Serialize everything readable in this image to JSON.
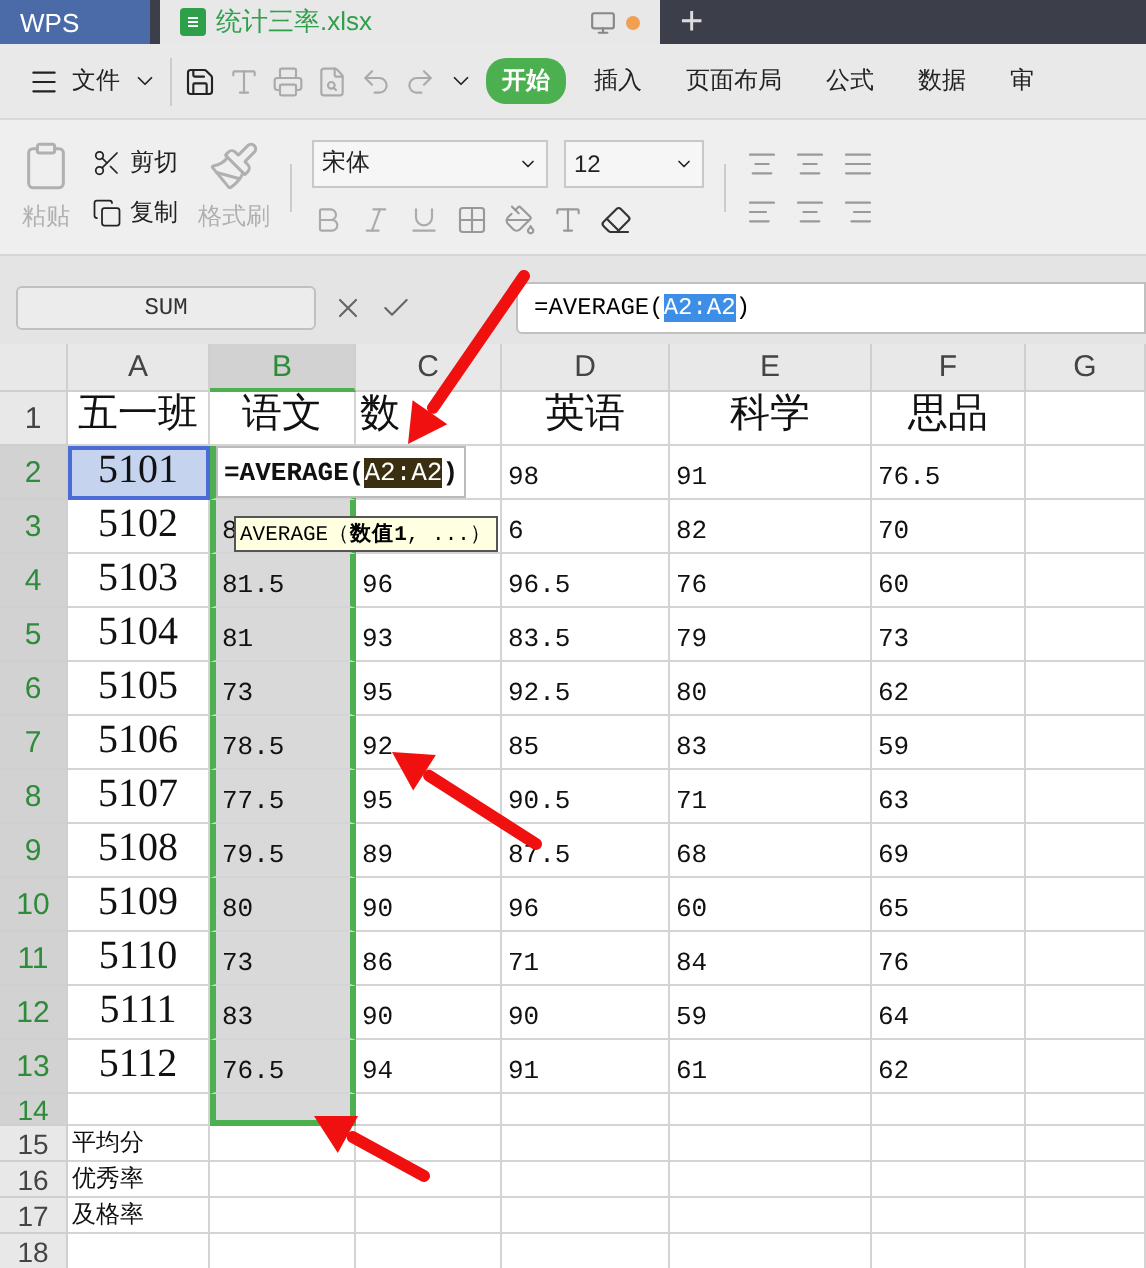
{
  "title_bar": {
    "app": "WPS",
    "tabs": [
      {
        "label": "统计三率.xlsx",
        "kind": "file",
        "selected": true
      }
    ],
    "new_tab": "+"
  },
  "menu": {
    "file": "文件",
    "tabs": [
      {
        "label": "开始",
        "selected": true
      },
      {
        "label": "插入",
        "selected": false
      },
      {
        "label": "页面布局",
        "selected": false
      },
      {
        "label": "公式",
        "selected": false
      },
      {
        "label": "数据",
        "selected": false
      },
      {
        "label": "审",
        "selected": false
      }
    ]
  },
  "ribbon": {
    "clipboard": [
      {
        "label": "粘贴",
        "kind": "paste",
        "disabled": true
      },
      {
        "label": "剪切",
        "kind": "cut",
        "disabled": false
      },
      {
        "label": "复制",
        "kind": "copy",
        "disabled": false
      },
      {
        "label": "格式刷",
        "kind": "painter",
        "disabled": true
      }
    ],
    "font": {
      "name": "宋体",
      "size": "12"
    }
  },
  "formula_bar": {
    "name_box": "SUM",
    "segments": [
      {
        "text": "=AVERAGE(",
        "selected": false
      },
      {
        "text": "A2:A2",
        "selected": true
      },
      {
        "text": ")",
        "selected": false
      }
    ]
  },
  "sheet": {
    "columns": [
      {
        "label": "A",
        "selected": false
      },
      {
        "label": "B",
        "selected": true
      },
      {
        "label": "C",
        "selected": false
      },
      {
        "label": "D",
        "selected": false
      },
      {
        "label": "E",
        "selected": false
      },
      {
        "label": "F",
        "selected": false
      },
      {
        "label": "G",
        "selected": false
      }
    ],
    "rows": [
      {
        "number": "1",
        "selected": false,
        "cells": [
          "五一班",
          "语文",
          {
            "text": "数",
            "kind": "left_aligned"
          },
          "英语",
          "科学",
          "思品",
          null
        ]
      },
      {
        "number": "2",
        "selected": true,
        "cells": [
          {
            "text": "5101",
            "active": true
          },
          {
            "kind": "editor",
            "segments": [
              {
                "text": "=AVERAGE(",
                "selected": false
              },
              {
                "text": "A2:A2",
                "selected": true
              },
              {
                "text": ")",
                "selected": false
              }
            ]
          },
          null,
          "98",
          "91",
          "76.5",
          null
        ]
      },
      {
        "number": "3",
        "selected": true,
        "cells": [
          "5102",
          "8",
          null,
          "6",
          "82",
          "70",
          null
        ]
      },
      {
        "number": "4",
        "selected": true,
        "cells": [
          "5103",
          "81.5",
          "96",
          "96.5",
          "76",
          "60",
          null
        ]
      },
      {
        "number": "5",
        "selected": true,
        "cells": [
          "5104",
          "81",
          "93",
          "83.5",
          "79",
          "73",
          null
        ]
      },
      {
        "number": "6",
        "selected": true,
        "cells": [
          "5105",
          "73",
          "95",
          "92.5",
          "80",
          "62",
          null
        ]
      },
      {
        "number": "7",
        "selected": true,
        "cells": [
          "5106",
          "78.5",
          "92",
          "85",
          "83",
          "59",
          null
        ]
      },
      {
        "number": "8",
        "selected": true,
        "cells": [
          "5107",
          "77.5",
          "95",
          "90.5",
          "71",
          "63",
          null
        ]
      },
      {
        "number": "9",
        "selected": true,
        "cells": [
          "5108",
          "79.5",
          "89",
          "87.5",
          "68",
          "69",
          null
        ]
      },
      {
        "number": "10",
        "selected": true,
        "cells": [
          "5109",
          "80",
          "90",
          "96",
          "60",
          "65",
          null
        ]
      },
      {
        "number": "11",
        "selected": true,
        "cells": [
          "5110",
          "73",
          "86",
          "71",
          "84",
          "76",
          null
        ]
      },
      {
        "number": "12",
        "selected": true,
        "cells": [
          "5111",
          "83",
          "90",
          "90",
          "59",
          "64",
          null
        ]
      },
      {
        "number": "13",
        "selected": true,
        "cells": [
          "5112",
          "76.5",
          "94",
          "91",
          "61",
          "62",
          null
        ]
      },
      {
        "number": "14",
        "selected": true,
        "cells": [
          null,
          null,
          null,
          null,
          null,
          null,
          null
        ]
      },
      {
        "number": "15",
        "selected": false,
        "cells": [
          "平均分",
          null,
          null,
          null,
          null,
          null,
          null
        ]
      },
      {
        "number": "16",
        "selected": false,
        "cells": [
          "优秀率",
          null,
          null,
          null,
          null,
          null,
          null
        ]
      },
      {
        "number": "17",
        "selected": false,
        "cells": [
          "及格率",
          null,
          null,
          null,
          null,
          null,
          null
        ]
      },
      {
        "number": "18",
        "selected": false,
        "cells": [
          null,
          null,
          null,
          null,
          null,
          null,
          null
        ]
      }
    ],
    "tooltip": "AVERAGE（**数值1**, ...）"
  }
}
